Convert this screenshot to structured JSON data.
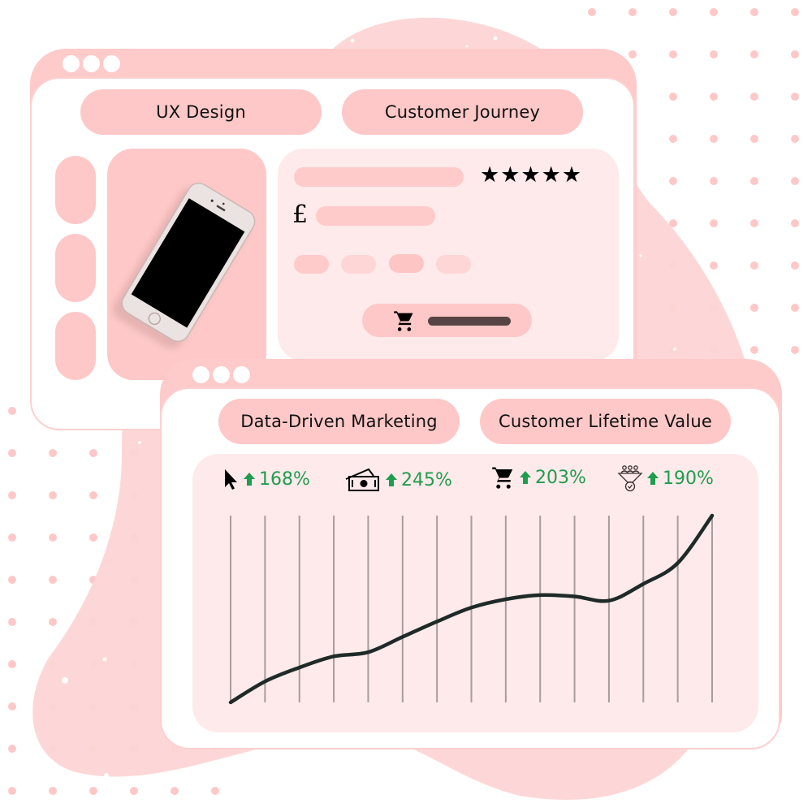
{
  "colors": {
    "frame": "#fecaca",
    "blob": "#fdd5d5",
    "card_light": "#feeaea",
    "pill": "#fec8c8",
    "positive": "#1f9d4e",
    "line": "#1e2a28",
    "grid": "#a89c9c",
    "cart_bar": "#574545"
  },
  "window_top": {
    "tabs": [
      {
        "label": "UX Design"
      },
      {
        "label": "Customer Journey"
      }
    ],
    "product": {
      "rating_stars": 5,
      "stars": "★★★★★",
      "currency_symbol": "£",
      "image": "smartphone-photo"
    }
  },
  "window_bottom": {
    "tabs": [
      {
        "label": "Data-Driven Marketing"
      },
      {
        "label": "Customer Lifetime Value"
      }
    ],
    "metrics": [
      {
        "icon": "cursor-icon",
        "arrow": "up",
        "value": "168%"
      },
      {
        "icon": "cash-icon",
        "arrow": "up",
        "value": "245%"
      },
      {
        "icon": "cart-icon",
        "arrow": "up",
        "value": "203%"
      },
      {
        "icon": "funnel-icon",
        "arrow": "up",
        "value": "190%"
      }
    ]
  },
  "chart_data": {
    "type": "line",
    "title": "",
    "xlabel": "",
    "ylabel": "",
    "x": [
      0,
      1,
      2,
      3,
      4,
      5,
      6,
      7,
      8,
      9,
      10,
      11,
      12,
      13,
      14
    ],
    "values": [
      0,
      15,
      25,
      33,
      36,
      47,
      58,
      68,
      74,
      77,
      76,
      73,
      85,
      100,
      134
    ],
    "ylim": [
      0,
      134
    ],
    "grid": "vertical",
    "legend": "none"
  }
}
